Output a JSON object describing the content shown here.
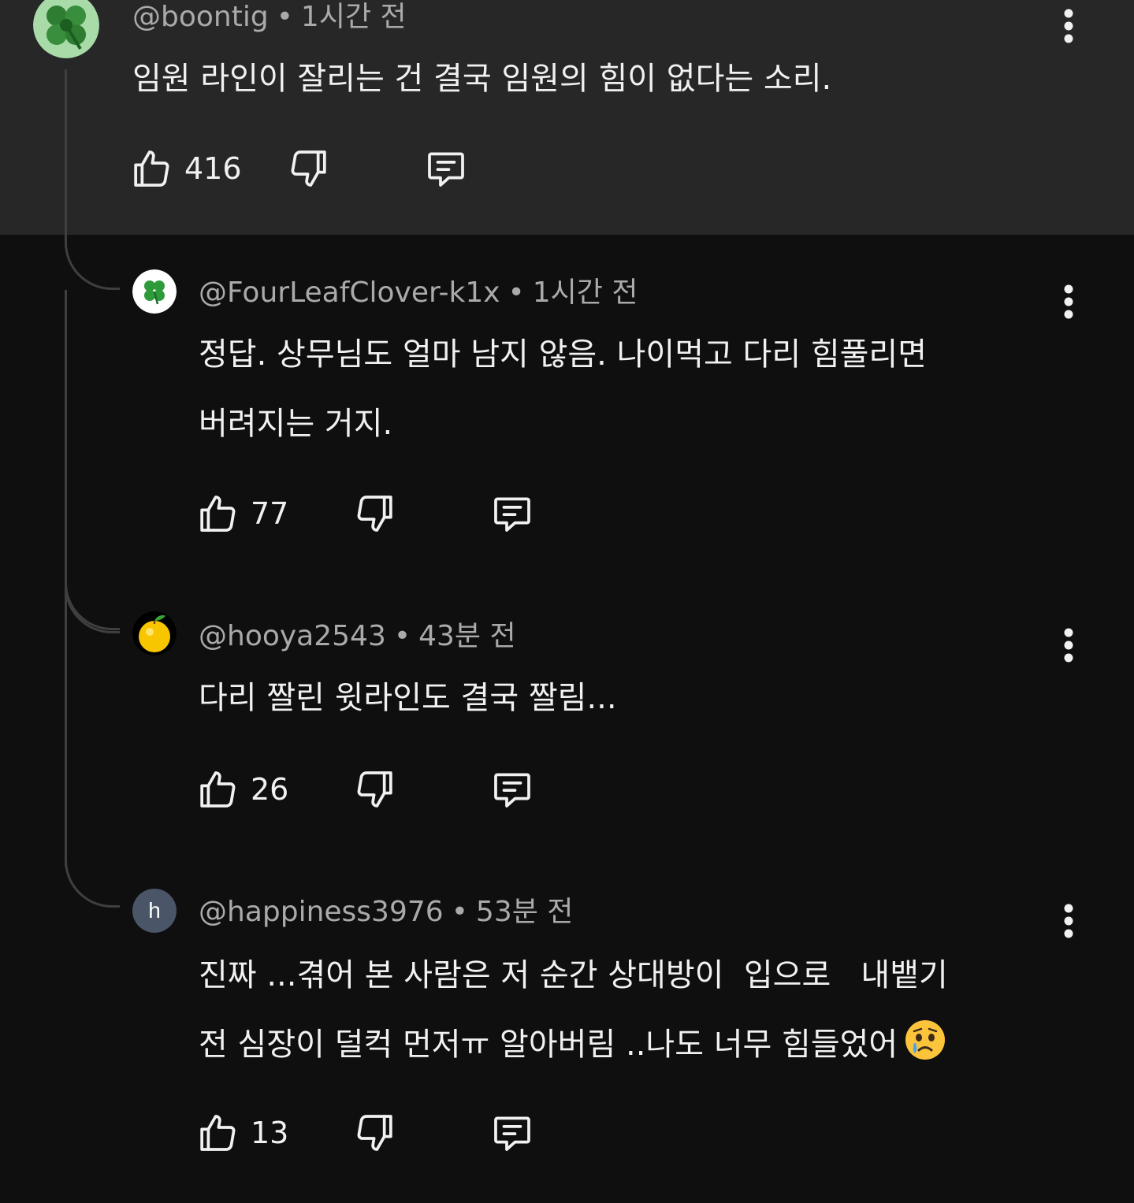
{
  "comments": [
    {
      "handle": "@boontig",
      "time": "1시간 전",
      "lines": [
        "임원 라인이 잘리는 건 결국 임원의 힘이 없다는 소리."
      ],
      "likes": "416",
      "avatar_icon": "clover-icon"
    },
    {
      "handle": "@FourLeafClover-k1x",
      "time": "1시간 전",
      "lines": [
        "정답. 상무님도 얼마 남지 않음. 나이먹고 다리 힘풀리면",
        "버려지는 거지."
      ],
      "likes": "77",
      "avatar_icon": "four-leaf-clover-icon"
    },
    {
      "handle": "@hooya2543",
      "time": "43분 전",
      "lines": [
        "다리 짤린 윗라인도 결국 짤림..."
      ],
      "likes": "26",
      "avatar_icon": "orange-fruit-icon"
    },
    {
      "handle": "@happiness3976",
      "time": "53분 전",
      "lines": [
        "진짜 ...겪어 본 사람은 저 순간 상대방이  입으로   내뱉기",
        "전 심장이 덜컥 먼저ㅠ 알아버림 ..나도 너무 힘들었어"
      ],
      "likes": "13",
      "avatar_letter": "h",
      "emoji_icon": "crying-face-emoji"
    }
  ],
  "dot_separator": "•",
  "colors": {
    "background": "#0f0f0f",
    "highlight_background": "#272727",
    "primary_text": "#f1f1f1",
    "secondary_text": "#aaaaaa",
    "thread_line": "#3f3f3f"
  }
}
